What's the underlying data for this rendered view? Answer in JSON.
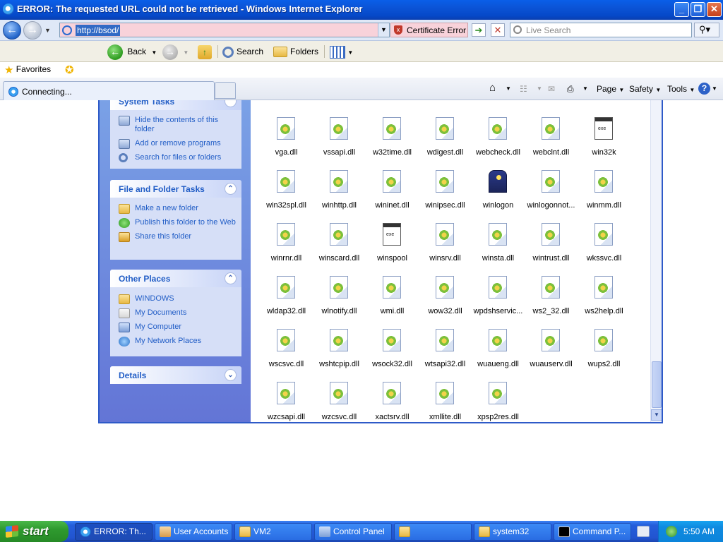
{
  "window": {
    "title": "ERROR: The requested URL could not be retrieved - Windows Internet Explorer",
    "min_label": "_",
    "max_label": "❐",
    "close_label": "✕"
  },
  "address_bar": {
    "url": "http://bsod/",
    "cert_error": "Certificate Error",
    "go_label": "➔",
    "stop_label": "✕",
    "search_placeholder": "Live Search"
  },
  "toolbar": {
    "back": "Back",
    "search": "Search",
    "folders": "Folders"
  },
  "favorites": {
    "label": "Favorites"
  },
  "tabs": [
    {
      "label": "Connecting..."
    }
  ],
  "command_bar": {
    "page": "Page",
    "safety": "Safety",
    "tools": "Tools"
  },
  "taskpane": {
    "system_tasks": {
      "title": "System Tasks",
      "items": [
        "Hide the contents of this folder",
        "Add or remove programs",
        "Search for files or folders"
      ]
    },
    "file_folder_tasks": {
      "title": "File and Folder Tasks",
      "items": [
        "Make a new folder",
        "Publish this folder to the Web",
        "Share this folder"
      ]
    },
    "other_places": {
      "title": "Other Places",
      "items": [
        "WINDOWS",
        "My Documents",
        "My Computer",
        "My Network Places"
      ]
    },
    "details": {
      "title": "Details"
    }
  },
  "files": [
    {
      "name": "vga.dll",
      "icon": "dll-icon"
    },
    {
      "name": "vssapi.dll",
      "icon": "dll-icon"
    },
    {
      "name": "w32time.dll",
      "icon": "dll-icon"
    },
    {
      "name": "wdigest.dll",
      "icon": "dll-icon"
    },
    {
      "name": "webcheck.dll",
      "icon": "dll-icon"
    },
    {
      "name": "webclnt.dll",
      "icon": "dll-icon"
    },
    {
      "name": "win32k",
      "icon": "exe-icon"
    },
    {
      "name": "win32spl.dll",
      "icon": "dll-icon"
    },
    {
      "name": "winhttp.dll",
      "icon": "dll-icon"
    },
    {
      "name": "wininet.dll",
      "icon": "dll-icon"
    },
    {
      "name": "winipsec.dll",
      "icon": "dll-icon"
    },
    {
      "name": "winlogon",
      "icon": "winlogon-icon"
    },
    {
      "name": "winlogonnot...",
      "icon": "dll-icon"
    },
    {
      "name": "winmm.dll",
      "icon": "dll-icon"
    },
    {
      "name": "winrnr.dll",
      "icon": "dll-icon"
    },
    {
      "name": "winscard.dll",
      "icon": "dll-icon"
    },
    {
      "name": "winspool",
      "icon": "exe-icon"
    },
    {
      "name": "winsrv.dll",
      "icon": "dll-icon"
    },
    {
      "name": "winsta.dll",
      "icon": "dll-icon"
    },
    {
      "name": "wintrust.dll",
      "icon": "dll-icon"
    },
    {
      "name": "wkssvc.dll",
      "icon": "dll-icon"
    },
    {
      "name": "wldap32.dll",
      "icon": "dll-icon"
    },
    {
      "name": "wlnotify.dll",
      "icon": "dll-icon"
    },
    {
      "name": "wmi.dll",
      "icon": "dll-icon"
    },
    {
      "name": "wow32.dll",
      "icon": "dll-icon"
    },
    {
      "name": "wpdshservic...",
      "icon": "dll-icon"
    },
    {
      "name": "ws2_32.dll",
      "icon": "dll-icon"
    },
    {
      "name": "ws2help.dll",
      "icon": "dll-icon"
    },
    {
      "name": "wscsvc.dll",
      "icon": "dll-icon"
    },
    {
      "name": "wshtcpip.dll",
      "icon": "dll-icon"
    },
    {
      "name": "wsock32.dll",
      "icon": "dll-icon"
    },
    {
      "name": "wtsapi32.dll",
      "icon": "dll-icon"
    },
    {
      "name": "wuaueng.dll",
      "icon": "dll-icon"
    },
    {
      "name": "wuauserv.dll",
      "icon": "dll-icon"
    },
    {
      "name": "wups2.dll",
      "icon": "dll-icon"
    },
    {
      "name": "wzcsapi.dll",
      "icon": "dll-icon"
    },
    {
      "name": "wzcsvc.dll",
      "icon": "dll-icon"
    },
    {
      "name": "xactsrv.dll",
      "icon": "dll-icon"
    },
    {
      "name": "xmllite.dll",
      "icon": "dll-icon"
    },
    {
      "name": "xpsp2res.dll",
      "icon": "dll-icon"
    }
  ],
  "taskbar": {
    "start": "start",
    "buttons": [
      {
        "label": "ERROR: Th...",
        "icon": "ie-icon",
        "active": true
      },
      {
        "label": "User Accounts",
        "icon": "users-icon",
        "active": false
      },
      {
        "label": "VM2",
        "icon": "folder-icon",
        "active": false
      },
      {
        "label": "Control Panel",
        "icon": "control-panel-icon",
        "active": false
      },
      {
        "label": "",
        "icon": "folder-icon",
        "active": false
      },
      {
        "label": "system32",
        "icon": "folder-icon",
        "active": false
      },
      {
        "label": "Command P...",
        "icon": "cmd-icon",
        "active": false
      }
    ],
    "clock": "5:50 AM"
  }
}
